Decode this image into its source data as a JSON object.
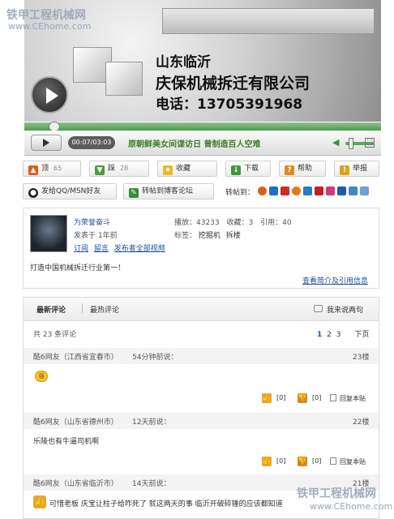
{
  "watermark": {
    "title": "铁甲工程机械网",
    "url": "www.CEhome.com"
  },
  "video": {
    "overlay_line1": "山东临沂",
    "overlay_line2": "庆保机械拆迁有限公司",
    "overlay_line3": "电话：13705391968"
  },
  "player": {
    "time": "00:07/03:03",
    "title": "原朝鲜美女间谍访日 曾制造百人空难"
  },
  "actions": {
    "up_label": "顶",
    "up_count": "65",
    "down_label": "踩",
    "down_count": "28",
    "favorite_label": "收藏",
    "download_label": "下载",
    "help_label": "帮助",
    "report_label": "举报",
    "send_qq_label": "发给QQ/MSN好友",
    "post_blog_label": "转帖到博客论坛",
    "share_label": "转帖到："
  },
  "author": {
    "name": "为荣誉奋斗",
    "published": "发表于 1年前",
    "links": [
      "订阅",
      "留言",
      "发布者全部视频"
    ],
    "stats": {
      "plays": "播放：43233",
      "favorites": "收藏：3",
      "quotes": "引用：40"
    },
    "tags_label": "标签：",
    "tags": [
      "挖掘机",
      "拆楼"
    ],
    "description": "打造中国机械拆迁行业第一！",
    "more_link": "查看简介及引用信息"
  },
  "comments": {
    "tabs": [
      "最新评论",
      "最热评论"
    ],
    "write_label": "我来说两句",
    "total": "共 23 条评论",
    "pages": [
      "1",
      "2",
      "3"
    ],
    "next": "下页",
    "items": [
      {
        "user": "酷6网友（江西省宜春市）",
        "time": "54分钟前说：",
        "floor": "23楼",
        "text": "",
        "up": "[0]",
        "down": "[0]",
        "reply": "回复本贴"
      },
      {
        "user": "酷6网友（山东省德州市）",
        "time": "12天前说：",
        "floor": "22楼",
        "text": "乐陵也有牛逼司机啊",
        "up": "[0]",
        "down": "[0]",
        "reply": "回复本贴"
      },
      {
        "user": "酷6网友（山东省临沂市）",
        "time": "14天前说：",
        "floor": "21楼",
        "text": "可惜老板 庆宝让柱子给咋死了 就这两天的事 临沂开破碎锤的应该都知道"
      }
    ]
  }
}
